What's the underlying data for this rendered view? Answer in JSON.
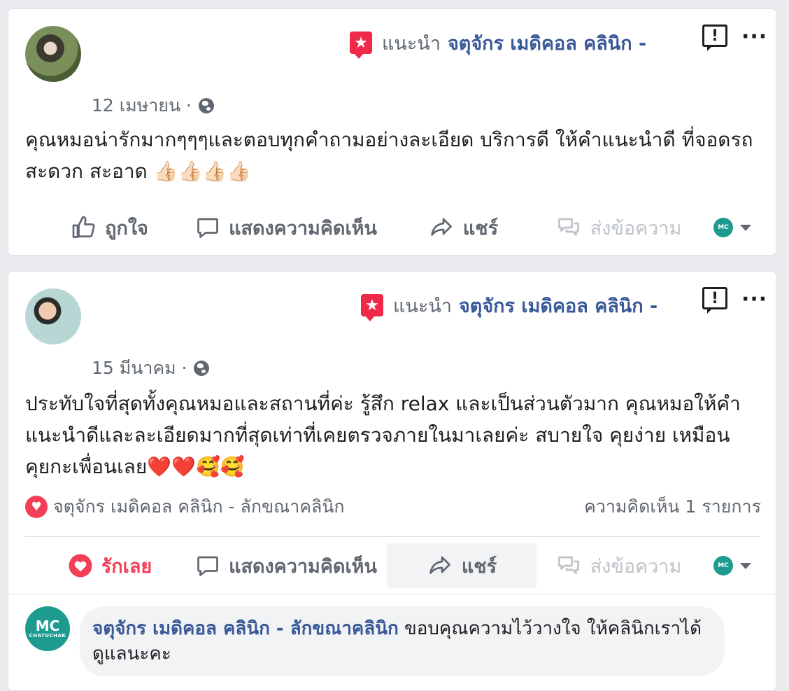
{
  "posts": [
    {
      "recommend_verb": "แนะนำ",
      "page_name": "จตุจักร เมดิคอล คลินิก -",
      "date": "12 เมษายน ·",
      "text": "คุณหมอน่ารักมากๆๆๆและตอบทุกคำถามอย่างละเอียด บริการดี ให้คำแนะนำดี ที่จอดรถสะดวก สะอาด",
      "emoji": "👍🏻👍🏻👍🏻👍🏻",
      "actions": {
        "like": "ถูกใจ",
        "comment": "แสดงความคิดเห็น",
        "share": "แชร์",
        "message": "ส่งข้อความ"
      }
    },
    {
      "recommend_verb": "แนะนำ",
      "page_name": "จตุจักร เมดิคอล คลินิก -",
      "date": "15 มีนาคม ·",
      "text": "ประทับใจที่สุดทั้งคุณหมอและสถานที่ค่ะ รู้สึก relax และเป็นส่วนตัวมาก คุณหมอให้คำแนะนำดีและละเอียดมากที่สุดเท่าที่เคยตรวจภายในมาเลยค่ะ สบายใจ คุยง่าย เหมือนคุยกะเพื่อนเลย",
      "emoji": "❤️❤️🥰🥰",
      "reactions_by": "จตุจักร เมดิคอล คลินิก - ลักขณาคลินิก",
      "comment_count": "ความคิดเห็น 1 รายการ",
      "actions": {
        "like": "รักเลย",
        "comment": "แสดงความคิดเห็น",
        "share": "แชร์",
        "message": "ส่งข้อความ"
      },
      "comment": {
        "author": "จตุจักร เมดิคอล คลินิก - ลักขณาคลินิก",
        "text": "ขอบคุณความไว้วางใจ ให้คลินิกเราได้ดูแลนะคะ",
        "avatar_text": "CHATUCHAK"
      }
    }
  ],
  "page_avatar_text": "MC",
  "colors": {
    "link": "#385898",
    "love": "#f33e58",
    "brand_teal": "#1d9b8f"
  }
}
